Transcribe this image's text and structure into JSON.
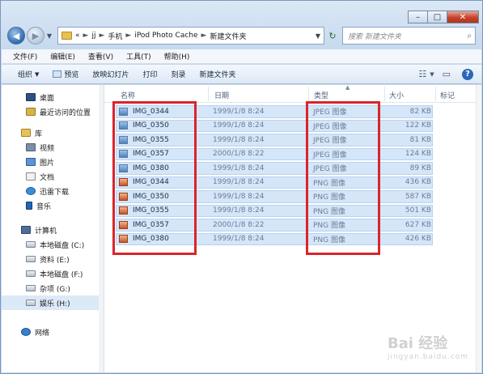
{
  "window": {
    "caption_buttons": {
      "minimize": "–",
      "maximize": "□",
      "close": "✕"
    }
  },
  "address": {
    "prefix": "«",
    "crumbs": [
      "jj",
      "手机",
      "iPod Photo Cache",
      "新建文件夹"
    ],
    "separator": "►",
    "search_placeholder": "搜索 新建文件夹"
  },
  "menubar": {
    "items": [
      "文件(F)",
      "编辑(E)",
      "查看(V)",
      "工具(T)",
      "帮助(H)"
    ]
  },
  "toolbar": {
    "items": [
      "组织",
      "预览",
      "放映幻灯片",
      "打印",
      "刻录",
      "新建文件夹"
    ]
  },
  "nav": {
    "favorites": [
      {
        "label": "桌面",
        "icon": "desktop-icon"
      },
      {
        "label": "最近访问的位置",
        "icon": "recent-places-icon"
      }
    ],
    "library_head": "库",
    "library": [
      {
        "label": "视频",
        "icon": "video-library-icon"
      },
      {
        "label": "图片",
        "icon": "pictures-library-icon"
      },
      {
        "label": "文档",
        "icon": "documents-library-icon"
      },
      {
        "label": "迅雷下载",
        "icon": "download-icon"
      },
      {
        "label": "音乐",
        "icon": "music-library-icon"
      }
    ],
    "computer_head": "计算机",
    "drives": [
      {
        "label": "本地磁盘 (C:)"
      },
      {
        "label": "资料 (E:)"
      },
      {
        "label": "本地磁盘 (F:)"
      },
      {
        "label": "杂项 (G:)"
      },
      {
        "label": "娱乐 (H:)"
      }
    ],
    "network": "网络"
  },
  "columns": {
    "name": "名称",
    "date": "日期",
    "type": "类型",
    "size": "大小",
    "tags": "标记"
  },
  "files": [
    {
      "name": "IMG_0344",
      "date": "1999/1/8 8:24",
      "type": "JPEG 图像",
      "size": "82 KB",
      "kind": "jpeg"
    },
    {
      "name": "IMG_0350",
      "date": "1999/1/8 8:24",
      "type": "JPEG 图像",
      "size": "122 KB",
      "kind": "jpeg"
    },
    {
      "name": "IMG_0355",
      "date": "1999/1/8 8:24",
      "type": "JPEG 图像",
      "size": "81 KB",
      "kind": "jpeg"
    },
    {
      "name": "IMG_0357",
      "date": "2000/1/8 8:22",
      "type": "JPEG 图像",
      "size": "124 KB",
      "kind": "jpeg"
    },
    {
      "name": "IMG_0380",
      "date": "1999/1/8 8:24",
      "type": "JPEG 图像",
      "size": "89 KB",
      "kind": "jpeg"
    },
    {
      "name": "IMG_0344",
      "date": "1999/1/8 8:24",
      "type": "PNG 图像",
      "size": "436 KB",
      "kind": "png"
    },
    {
      "name": "IMG_0350",
      "date": "1999/1/8 8:24",
      "type": "PNG 图像",
      "size": "587 KB",
      "kind": "png"
    },
    {
      "name": "IMG_0355",
      "date": "1999/1/8 8:24",
      "type": "PNG 图像",
      "size": "501 KB",
      "kind": "png"
    },
    {
      "name": "IMG_0357",
      "date": "2000/1/8 8:22",
      "type": "PNG 图像",
      "size": "627 KB",
      "kind": "png"
    },
    {
      "name": "IMG_0380",
      "date": "1999/1/8 8:24",
      "type": "PNG 图像",
      "size": "426 KB",
      "kind": "png"
    }
  ],
  "watermark": {
    "text": "Bai 经验",
    "sub": "jingyan.baidu.com"
  },
  "colors": {
    "highlight": "#d9252c",
    "selection": "#d5e6f9"
  }
}
